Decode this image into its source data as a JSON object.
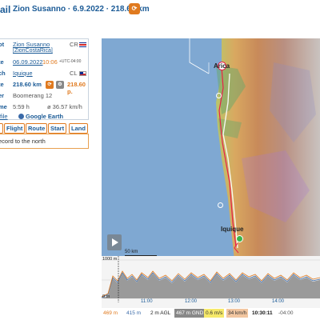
{
  "header": {
    "title_fragment": "ail",
    "pilot_and_flight": "Zion Susanno · 6.9.2022 · 218.60 km"
  },
  "details": {
    "pilot_label": "ot",
    "pilot_name": "Zion Susanno",
    "pilot_handle": "[ZionCostaRica]",
    "pilot_country": "CR",
    "date_label": "te",
    "date": "06.09.2022",
    "time": "10:06",
    "utc": "+UTC-04:00",
    "launch_label": "ch",
    "launch": "Iquique",
    "launch_country": "CL",
    "distance_label": "te",
    "distance": "218.60 km",
    "points": "218.60 p.",
    "glider_label": "er",
    "glider": "Boomerang 12",
    "duration_label": "me",
    "duration": "5:59 h",
    "avg_speed": "ø 36.57 km/h"
  },
  "links": {
    "file": "file",
    "google_earth": "Google Earth"
  },
  "tabs": [
    "Flight",
    "Route",
    "Start",
    "Land"
  ],
  "comment": "ecord to the north",
  "map": {
    "city_north": "Arica",
    "city_south": "Iquique",
    "scale": "50 km"
  },
  "profile": {
    "y_top": "1000 m",
    "y_bottom": "0 m",
    "times": [
      "11:00",
      "12:00",
      "13:00",
      "14:00"
    ]
  },
  "status_bar": {
    "alt": "469 m",
    "alt2": "415 m",
    "agl": "2 m AGL",
    "gnd": "467 m GND",
    "vario": "0.6 m/s",
    "speed": "34 km/h",
    "clock": "10:30:11",
    "tz": "-04:00"
  },
  "colors": {
    "accent_orange": "#e07a1f",
    "link_blue": "#1a5a96",
    "sea": "#7fa8d2"
  }
}
